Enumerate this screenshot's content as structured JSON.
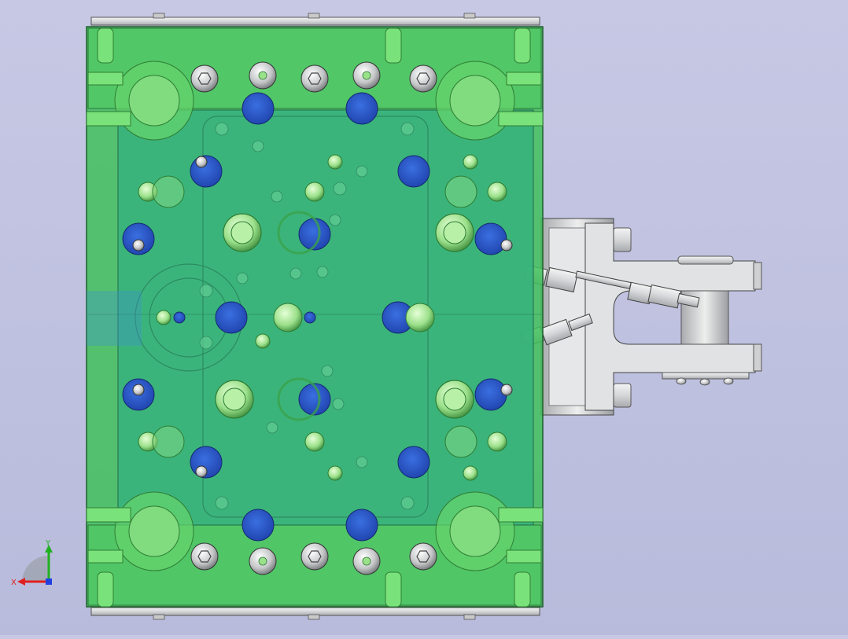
{
  "viewport": {
    "background_top": "#c6c8e4",
    "background_bottom": "#b9bbdc",
    "plate_color": "#3fbf5a",
    "cavity_color": "#37b27e",
    "bolt_color": "#bfc2c4",
    "cooling_color": "#2d55c8",
    "fitting_color": "#d9d9d9"
  },
  "triad": {
    "x_label": "X",
    "y_label": "Y",
    "x_color": "#e02020",
    "y_color": "#20b020",
    "z_color": "#2040e0"
  }
}
